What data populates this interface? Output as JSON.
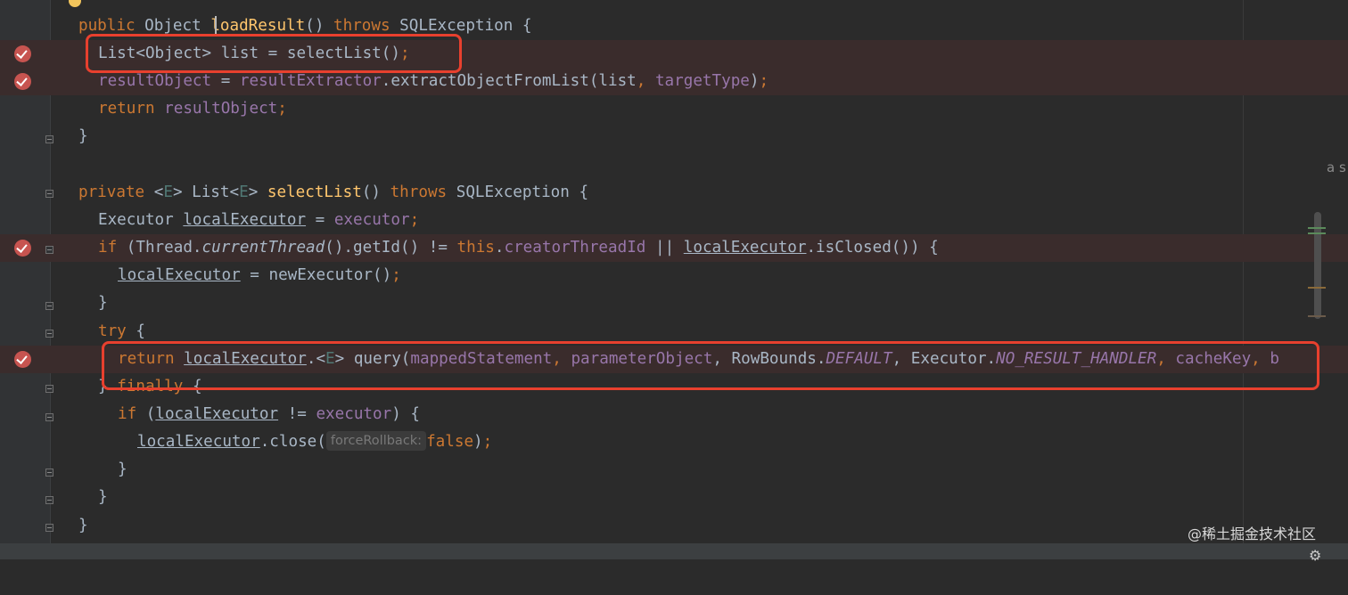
{
  "editor": {
    "line1": {
      "t1": "public",
      "t2": " Object ",
      "t3": "loadResult",
      "t4": "() ",
      "t5": "throws",
      "t6": " SQLException {"
    },
    "line2": {
      "t1": "List<Object> list = selectList()",
      "t2": ";"
    },
    "line3": {
      "t1": "resultObject",
      "t2": " = ",
      "t3": "resultExtractor",
      "t4": ".extractObjectFromList(list",
      "t5": ", ",
      "t6": "targetType",
      "t7": ")",
      "t8": ";"
    },
    "line4": {
      "t1": "return ",
      "t2": "resultObject",
      "t3": ";"
    },
    "line5": {
      "t1": "}"
    },
    "line6": {
      "t1": "private ",
      "t2": "<",
      "t3": "E",
      "t4": "> List<",
      "t5": "E",
      "t6": "> ",
      "t7": "selectList",
      "t8": "() ",
      "t9": "throws",
      "t10": " SQLException {"
    },
    "line7": {
      "t1": "Executor ",
      "t2": "localExecutor",
      "t3": " = ",
      "t4": "executor",
      "t5": ";"
    },
    "line8": {
      "t1": "if ",
      "t2": "(Thread.",
      "t3": "currentThread",
      "t4": "().getId() != ",
      "t5": "this",
      "t6": ".",
      "t7": "creatorThreadId",
      "t8": " || ",
      "t9": "localExecutor",
      "t10": ".isClosed()) {"
    },
    "line9": {
      "t1": "localExecutor",
      "t2": " = newExecutor()",
      "t3": ";"
    },
    "line10": {
      "t1": "}"
    },
    "line11": {
      "t1": "try ",
      "t2": "{"
    },
    "line12": {
      "t1": "return ",
      "t2": "localExecutor",
      "t3": ".<",
      "t4": "E",
      "t5": "> query(",
      "t6": "mappedStatement",
      "t7": ", ",
      "t8": "parameterObject",
      "t9": ", RowBounds.",
      "t10": "DEFAULT",
      "t11": ", Executor.",
      "t12": "NO_RESULT_HANDLER",
      "t13": ", ",
      "t14": "cacheKey",
      "t15": ", ",
      "t16": "b"
    },
    "line13": {
      "t1": "} ",
      "t2": "finally ",
      "t3": "{"
    },
    "line14": {
      "t1": "if ",
      "t2": "(",
      "t3": "localExecutor",
      "t4": " != ",
      "t5": "executor",
      "t6": ") {"
    },
    "line15": {
      "t1": "localExecutor",
      "t2": ".close(",
      "hint": "forceRollback:",
      "t3": "false",
      "t4": ")",
      "t5": ";"
    },
    "line16": {
      "t1": "}"
    },
    "line17": {
      "t1": "}"
    },
    "line18": {
      "t1": "}"
    }
  },
  "side_text": "a s",
  "watermark": "@稀土掘金技术社区",
  "icons": {
    "breakpoint": "breakpoint-check-icon",
    "fold": "fold-marker-icon",
    "bulb": "lightbulb-icon",
    "gear": "gear-icon"
  },
  "colors": {
    "keyword": "#cc7832",
    "field": "#9876aa",
    "method": "#ffc66d",
    "generic": "#507874",
    "highlight_box": "#e8402e",
    "breakpoint": "#c75450"
  }
}
